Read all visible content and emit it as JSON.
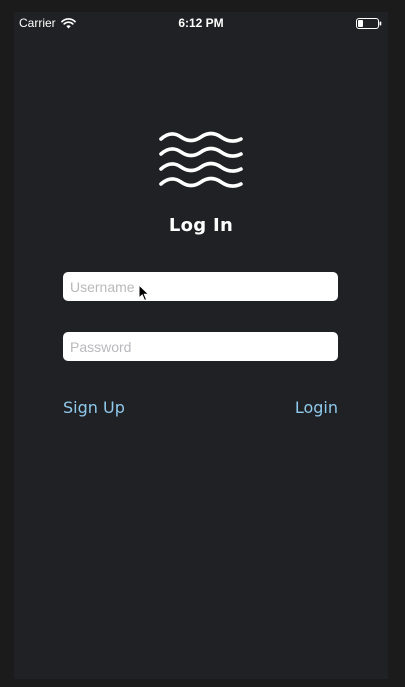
{
  "status_bar": {
    "carrier": "Carrier",
    "time": "6:12 PM",
    "wifi_icon": "wifi-icon",
    "battery_icon": "battery-icon"
  },
  "logo": {
    "icon": "waves-icon",
    "color": "#ffffff"
  },
  "title": "Log In",
  "form": {
    "username": {
      "value": "",
      "placeholder": "Username"
    },
    "password": {
      "value": "",
      "placeholder": "Password"
    }
  },
  "actions": {
    "sign_up_label": "Sign Up",
    "login_label": "Login",
    "link_color": "#8fc9ec"
  },
  "colors": {
    "background": "#202124",
    "outer_frame": "#1b1b1c",
    "input_background": "#ffffff"
  }
}
